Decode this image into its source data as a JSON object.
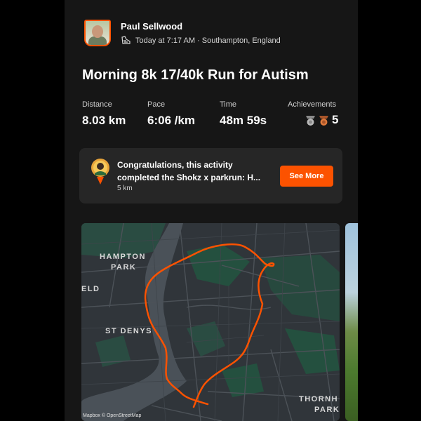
{
  "user": {
    "name": "Paul Sellwood",
    "avatar": "user-avatar"
  },
  "activity": {
    "icon": "shoe-icon",
    "meta": "Today at 7:17 AM · Southampton, England",
    "title": "Morning 8k 17/40k Run for Autism"
  },
  "stats": {
    "distance": {
      "label": "Distance",
      "value": "8.03 km"
    },
    "pace": {
      "label": "Pace",
      "value": "6:06 /km"
    },
    "time": {
      "label": "Time",
      "value": "48m 59s"
    },
    "achievements": {
      "label": "Achievements",
      "count": "5",
      "icons": [
        "silver-medal-icon",
        "bronze-medal-icon"
      ]
    }
  },
  "congrats": {
    "badge": "parkrun-badge-icon",
    "message_line1": "Congratulations, this activity",
    "message_line2": "completed the Shokz x parkrun: H...",
    "sub": "5 km",
    "button": "See More"
  },
  "map": {
    "places": [
      "HAMPTON",
      "PARK",
      "ELD",
      "ST DENYS",
      "THORNH",
      "PARK"
    ],
    "attribution": "Mapbox © OpenStreetMap",
    "route_color": "#fc5200"
  },
  "colors": {
    "accent": "#fc5200",
    "background": "#161616",
    "card": "#262626"
  }
}
